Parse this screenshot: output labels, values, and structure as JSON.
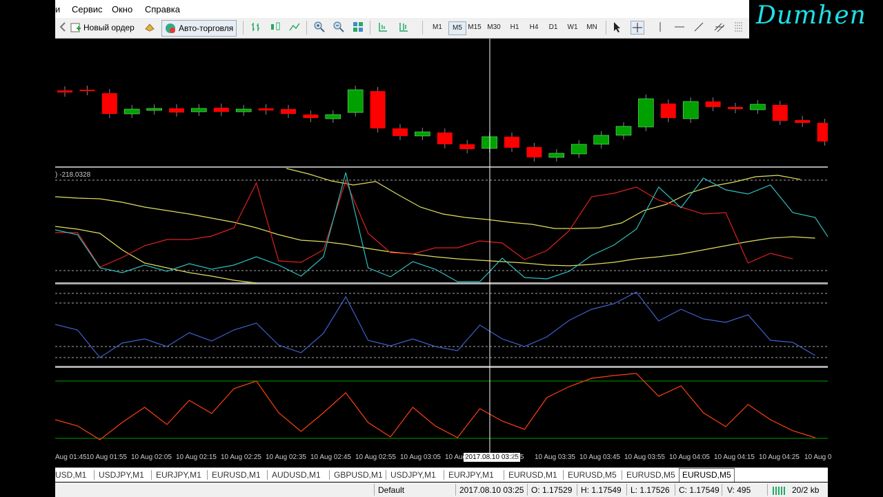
{
  "menu": {
    "item_partial": "и",
    "service": "Сервис",
    "window": "Окно",
    "help": "Справка"
  },
  "toolbar": {
    "new_order": "Новый ордер",
    "auto_trading": "Авто-торговля",
    "timeframes": [
      "M1",
      "M5",
      "M15",
      "M30",
      "H1",
      "H4",
      "D1",
      "W1",
      "MN"
    ],
    "active_timeframe": "M5"
  },
  "logo": "Dumhen",
  "indicator_label": ") -218.0328",
  "chart_data": {
    "type": "candlestick",
    "symbol": "EURUSD",
    "timeframe": "M5",
    "time_labels": [
      "Aug 01:45",
      "10 Aug 01:55",
      "10 Aug 02:05",
      "10 Aug 02:15",
      "10 Aug 02:25",
      "10 Aug 02:35",
      "10 Aug 02:45",
      "10 Aug 02:55",
      "10 Aug 03:05",
      "10 Aug",
      "3:25",
      "10 Aug 03:35",
      "10 Aug 03:45",
      "10 Aug 03:55",
      "10 Aug 04:05",
      "10 Aug 04:15",
      "10 Aug 04:25",
      "10 Aug 0"
    ],
    "crosshair_time": "2017.08.10 03:25",
    "candles": [
      {
        "o": 131,
        "c": 134
      },
      {
        "o": 130,
        "c": 132
      },
      {
        "o": 135,
        "c": 165
      },
      {
        "o": 165,
        "c": 158
      },
      {
        "o": 160,
        "c": 157
      },
      {
        "o": 157,
        "c": 163
      },
      {
        "o": 162,
        "c": 157
      },
      {
        "o": 156,
        "c": 162
      },
      {
        "o": 162,
        "c": 158
      },
      {
        "o": 157,
        "c": 160
      },
      {
        "o": 158,
        "c": 165
      },
      {
        "o": 166,
        "c": 171
      },
      {
        "o": 172,
        "c": 166
      },
      {
        "o": 163,
        "c": 130
      },
      {
        "o": 132,
        "c": 186
      },
      {
        "o": 186,
        "c": 197
      },
      {
        "o": 197,
        "c": 191
      },
      {
        "o": 192,
        "c": 209
      },
      {
        "o": 209,
        "c": 216
      },
      {
        "o": 215,
        "c": 198
      },
      {
        "o": 198,
        "c": 214
      },
      {
        "o": 213,
        "c": 228
      },
      {
        "o": 228,
        "c": 222
      },
      {
        "o": 223,
        "c": 209
      },
      {
        "o": 209,
        "c": 196
      },
      {
        "o": 196,
        "c": 183
      },
      {
        "o": 184,
        "c": 143
      },
      {
        "o": 150,
        "c": 171
      },
      {
        "o": 172,
        "c": 147
      },
      {
        "o": 147,
        "c": 155
      },
      {
        "o": 155,
        "c": 158
      },
      {
        "o": 159,
        "c": 151
      },
      {
        "o": 152,
        "c": 175
      },
      {
        "o": 174,
        "c": 178
      },
      {
        "o": 178,
        "c": 205
      }
    ],
    "ma_panel": {
      "red": [
        337,
        337,
        387,
        373,
        356,
        347,
        347,
        342,
        330,
        265,
        378,
        380,
        362,
        262,
        338,
        366,
        368,
        359,
        359,
        349,
        352,
        376,
        363,
        334,
        285,
        280,
        271,
        290,
        300,
        310,
        308,
        381,
        367,
        375
      ],
      "cyan": [
        333,
        340,
        388,
        395,
        384,
        393,
        382,
        390,
        384,
        372,
        384,
        400,
        372,
        250,
        388,
        401,
        379,
        390,
        408,
        408,
        374,
        402,
        404,
        393,
        370,
        355,
        332,
        271,
        301,
        258,
        275,
        281,
        268,
        308,
        315,
        364
      ],
      "yellow_fast": [
        328,
        332,
        338,
        362,
        381,
        388,
        395,
        400,
        406,
        410
      ],
      "yellow_slow": [
        285,
        287,
        288,
        293,
        300,
        305,
        310,
        316,
        322,
        330,
        340,
        348,
        350,
        354,
        360,
        365,
        368,
        372,
        375,
        377,
        379,
        381,
        384,
        385,
        383,
        380,
        375,
        372,
        368,
        362,
        356,
        350,
        345,
        343,
        345
      ],
      "yellow_top": [
        244,
        252,
        262,
        268,
        263,
        282,
        300,
        310,
        315,
        318,
        322,
        325,
        331,
        331,
        330,
        323,
        305,
        296,
        280,
        270,
        264,
        256,
        254,
        260
      ]
    },
    "blue_panel": [
      470,
      478,
      518,
      497,
      491,
      502,
      482,
      494,
      478,
      468,
      500,
      511,
      483,
      430,
      493,
      501,
      491,
      502,
      508,
      471,
      491,
      502,
      488,
      464,
      448,
      440,
      423,
      465,
      448,
      462,
      467,
      456,
      493,
      496,
      515
    ],
    "orange_panel": [
      608,
      617,
      637,
      612,
      590,
      615,
      580,
      599,
      563,
      552,
      598,
      625,
      598,
      569,
      612,
      633,
      590,
      617,
      634,
      592,
      610,
      622,
      576,
      560,
      548,
      544,
      541,
      574,
      559,
      598,
      618,
      586,
      608,
      624,
      634
    ]
  },
  "tabs": [
    "USD,M1",
    "USDJPY,M1",
    "EURJPY,M1",
    "EURUSD,M1",
    "AUDUSD,M1",
    "GBPUSD,M1",
    "USDJPY,M1",
    "EURJPY,M1",
    "EURUSD,M1",
    "EURUSD,M5",
    "EURUSD,M5",
    "EURUSD,M5"
  ],
  "status": {
    "profile": "Default",
    "time": "2017.08.10 03:25",
    "open": "O: 1.17529",
    "high": "H: 1.17549",
    "low": "L: 1.17526",
    "close": "C: 1.17549",
    "volume": "V: 495",
    "traffic": "20/2 kb"
  },
  "colors": {
    "bull": "#00a000",
    "bear": "#ff0000",
    "ma_red": "#e02020",
    "ma_cyan": "#30c0c0",
    "ma_yellow": "#e0e060",
    "blue": "#4060d0",
    "orange": "#ff4010",
    "level_green": "#00a000"
  }
}
